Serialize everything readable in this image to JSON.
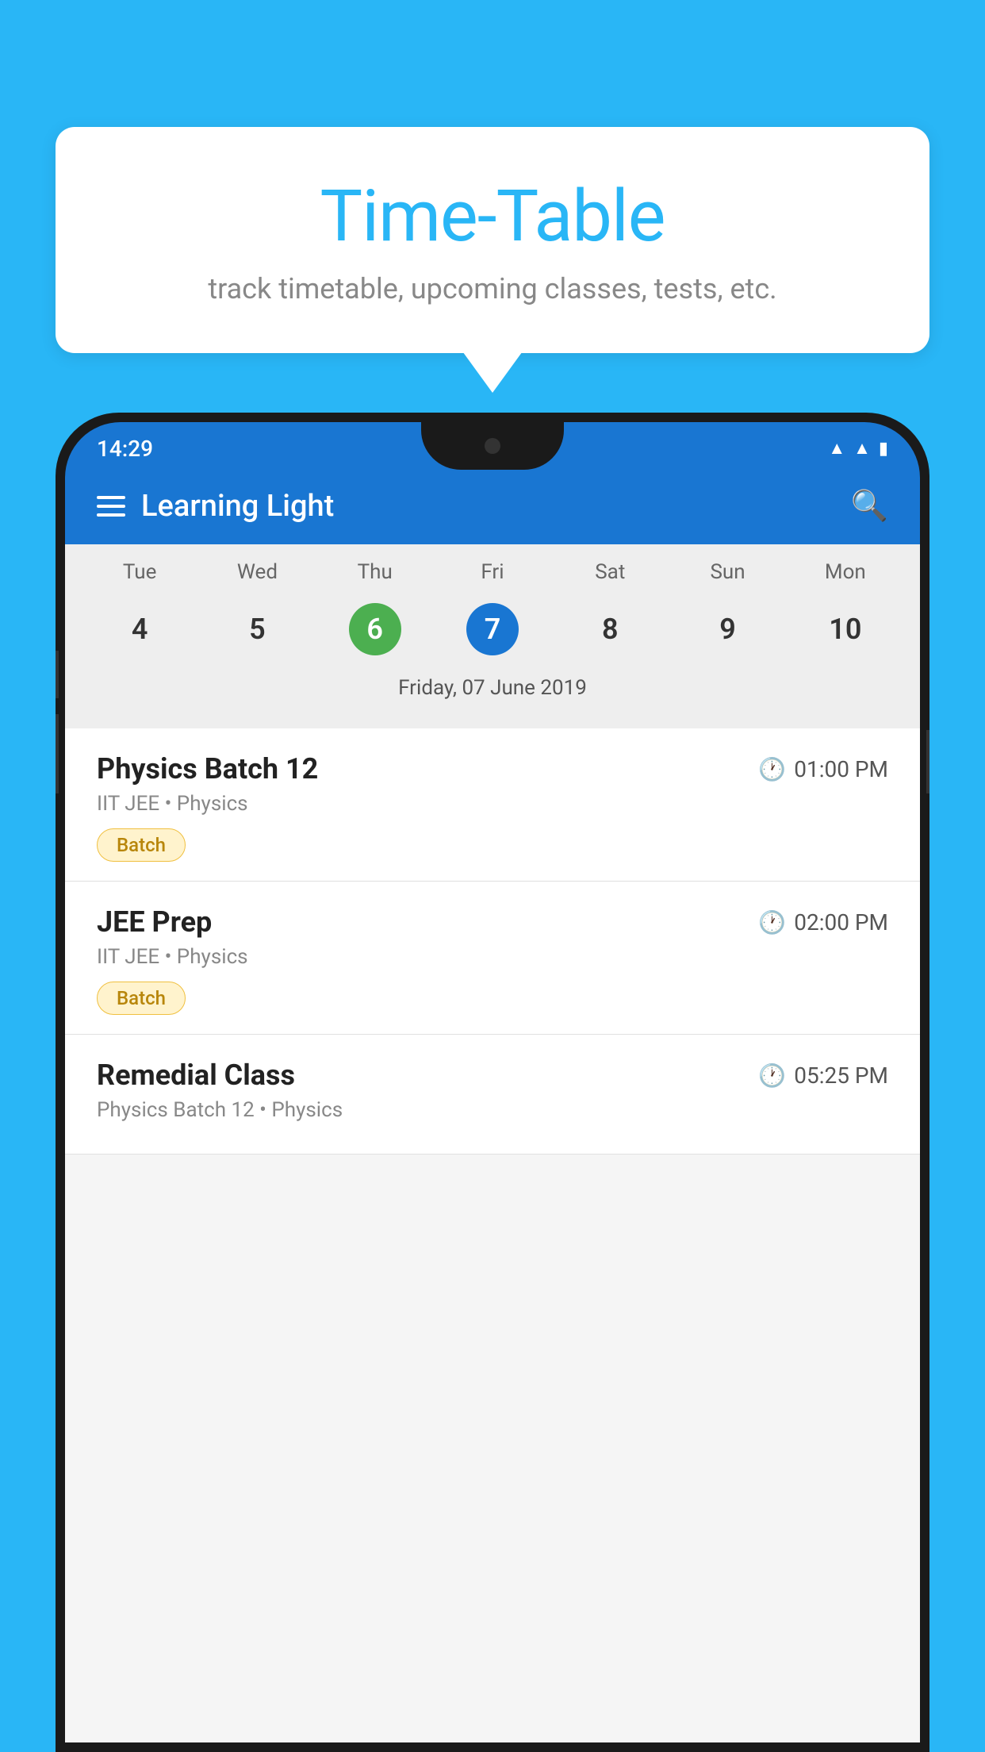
{
  "background_color": "#29B6F6",
  "bubble": {
    "title": "Time-Table",
    "subtitle": "track timetable, upcoming classes, tests, etc."
  },
  "status_bar": {
    "time": "14:29"
  },
  "app_bar": {
    "title": "Learning Light"
  },
  "calendar": {
    "day_names": [
      "Tue",
      "Wed",
      "Thu",
      "Fri",
      "Sat",
      "Sun",
      "Mon"
    ],
    "day_numbers": [
      "4",
      "5",
      "6",
      "7",
      "8",
      "9",
      "10"
    ],
    "today_index": 2,
    "selected_index": 3,
    "selected_date_label": "Friday, 07 June 2019"
  },
  "schedule": [
    {
      "title": "Physics Batch 12",
      "time": "01:00 PM",
      "subtitle": "IIT JEE • Physics",
      "badge": "Batch"
    },
    {
      "title": "JEE Prep",
      "time": "02:00 PM",
      "subtitle": "IIT JEE • Physics",
      "badge": "Batch"
    },
    {
      "title": "Remedial Class",
      "time": "05:25 PM",
      "subtitle": "Physics Batch 12 • Physics",
      "badge": null
    }
  ]
}
